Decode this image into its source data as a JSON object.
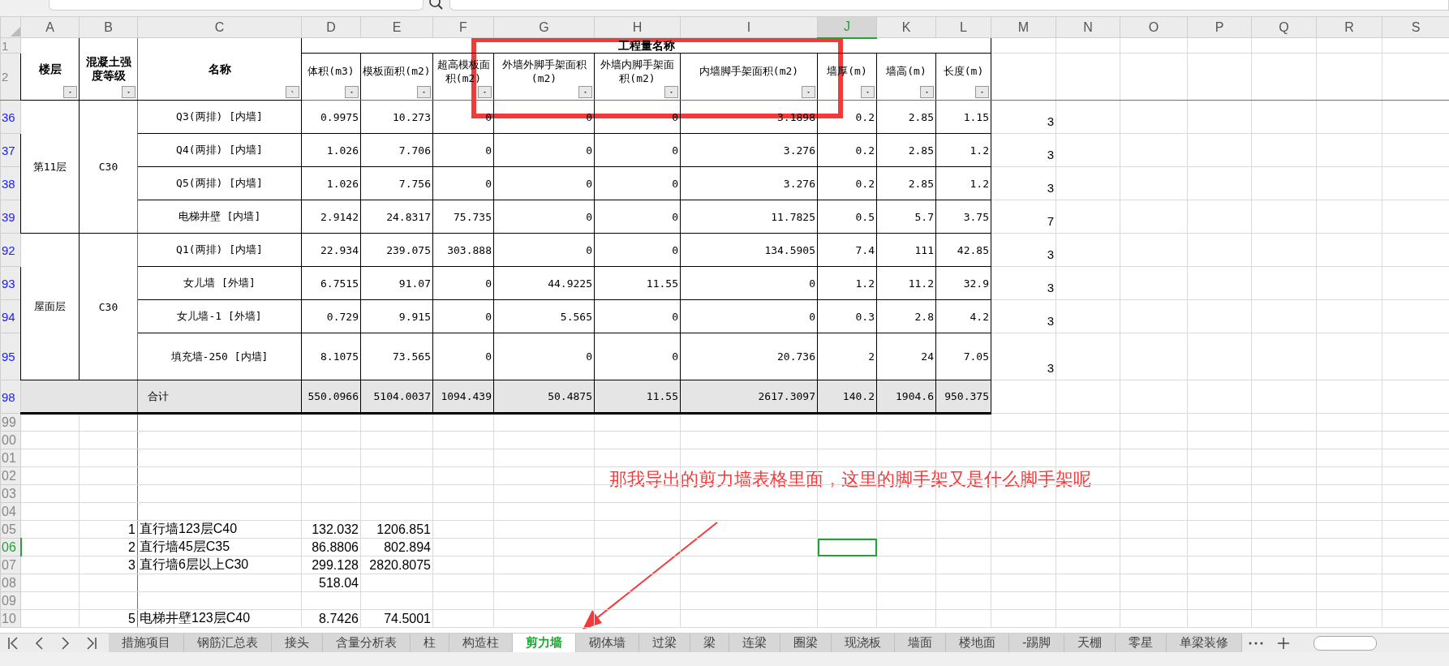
{
  "columns": [
    {
      "letter": "A",
      "selected": false
    },
    {
      "letter": "B",
      "selected": false
    },
    {
      "letter": "C",
      "selected": false
    },
    {
      "letter": "D",
      "selected": false
    },
    {
      "letter": "E",
      "selected": false
    },
    {
      "letter": "F",
      "selected": false
    },
    {
      "letter": "G",
      "selected": false
    },
    {
      "letter": "H",
      "selected": false
    },
    {
      "letter": "I",
      "selected": false
    },
    {
      "letter": "J",
      "selected": true
    },
    {
      "letter": "K",
      "selected": false
    },
    {
      "letter": "L",
      "selected": false
    },
    {
      "letter": "M",
      "selected": false
    },
    {
      "letter": "N",
      "selected": false
    },
    {
      "letter": "O",
      "selected": false
    },
    {
      "letter": "P",
      "selected": false
    },
    {
      "letter": "Q",
      "selected": false
    },
    {
      "letter": "R",
      "selected": false
    },
    {
      "letter": "S",
      "selected": false
    }
  ],
  "header": {
    "row_labels": [
      "1",
      "2"
    ],
    "frozen": [
      {
        "label": "楼层",
        "filter_applied": false
      },
      {
        "label": "混凝土强度等级",
        "filter_applied": false
      },
      {
        "label": "名称",
        "filter_applied": true
      }
    ],
    "group_title": "工程量名称",
    "fields": [
      {
        "label": "体积(m3)",
        "filter_applied": false
      },
      {
        "label": "模板面积(m2)",
        "filter_applied": false
      },
      {
        "label": "超高模板面积(m2)",
        "filter_applied": false
      },
      {
        "label": "外墙外脚手架面积(m2)",
        "filter_applied": false
      },
      {
        "label": "外墙内脚手架面积(m2)",
        "filter_applied": false
      },
      {
        "label": "内墙脚手架面积(m2)",
        "filter_applied": false
      },
      {
        "label": "墙厚(m)",
        "filter_applied": false
      },
      {
        "label": "墙高(m)",
        "filter_applied": false
      },
      {
        "label": "长度(m)",
        "filter_applied": false
      }
    ]
  },
  "groups": [
    {
      "floor": "第11层",
      "grade": "C30",
      "rows": [
        {
          "row": "36",
          "name": "Q3(两排) [内墙]",
          "values": [
            "0.9975",
            "10.273",
            "0",
            "0",
            "0",
            "3.1898",
            "0.2",
            "2.85",
            "1.15"
          ],
          "column_m": "3"
        },
        {
          "row": "37",
          "name": "Q4(两排) [内墙]",
          "values": [
            "1.026",
            "7.706",
            "0",
            "0",
            "0",
            "3.276",
            "0.2",
            "2.85",
            "1.2"
          ],
          "column_m": "3"
        },
        {
          "row": "38",
          "name": "Q5(两排) [内墙]",
          "values": [
            "1.026",
            "7.756",
            "0",
            "0",
            "0",
            "3.276",
            "0.2",
            "2.85",
            "1.2"
          ],
          "column_m": "3"
        },
        {
          "row": "39",
          "name": "电梯井壁 [内墙]",
          "values": [
            "2.9142",
            "24.8317",
            "75.735",
            "0",
            "0",
            "11.7825",
            "0.5",
            "5.7",
            "3.75"
          ],
          "column_m": "7"
        }
      ]
    },
    {
      "floor": "屋面层",
      "grade": "C30",
      "rows": [
        {
          "row": "92",
          "name": "Q1(两排) [内墙]",
          "values": [
            "22.934",
            "239.075",
            "303.888",
            "0",
            "0",
            "134.5905",
            "7.4",
            "111",
            "42.85"
          ],
          "column_m": "3"
        },
        {
          "row": "93",
          "name": "女儿墙 [外墙]",
          "values": [
            "6.7515",
            "91.07",
            "0",
            "44.9225",
            "11.55",
            "0",
            "1.2",
            "11.2",
            "32.9"
          ],
          "column_m": "3"
        },
        {
          "row": "94",
          "name": "女儿墙-1 [外墙]",
          "values": [
            "0.729",
            "9.915",
            "0",
            "5.565",
            "0",
            "0",
            "0.3",
            "2.8",
            "4.2"
          ],
          "column_m": "3"
        },
        {
          "row": "95",
          "name": "填充墙-250 [内墙]",
          "values": [
            "8.1075",
            "73.565",
            "0",
            "0",
            "0",
            "20.736",
            "2",
            "24",
            "7.05"
          ],
          "column_m": "3"
        }
      ]
    }
  ],
  "total": {
    "row": "98",
    "label": "合计",
    "values": [
      "550.0966",
      "5104.0037",
      "1094.439",
      "50.4875",
      "11.55",
      "2617.3097",
      "140.2",
      "1904.6",
      "950.375"
    ]
  },
  "extra_rows": [
    {
      "row": "99",
      "selected": false
    },
    {
      "row": "00",
      "selected": false
    },
    {
      "row": "01",
      "selected": false
    },
    {
      "row": "02",
      "selected": false
    },
    {
      "row": "03",
      "selected": false
    },
    {
      "row": "04",
      "selected": false
    },
    {
      "row": "05",
      "selected": false,
      "number": "1",
      "name": "直行墙123层C40",
      "volume": "132.032",
      "formwork": "1206.851"
    },
    {
      "row": "06",
      "selected": true,
      "number": "2",
      "name": "直行墙45层C35",
      "volume": "86.8806",
      "formwork": "802.894"
    },
    {
      "row": "07",
      "selected": false,
      "number": "3",
      "name": "直行墙6层以上C30",
      "volume": "299.128",
      "formwork": "2820.8075"
    },
    {
      "row": "08",
      "selected": false,
      "volume": "518.04"
    },
    {
      "row": "09",
      "selected": false
    },
    {
      "row": "10",
      "selected": false,
      "number": "5",
      "name": "电梯井壁123层C40",
      "volume": "8.7426",
      "formwork": "74.5001"
    }
  ],
  "annotation": {
    "text": "那我导出的剪力墙表格里面，这里的脚手架又是什么脚手架呢"
  },
  "sheet_tabs": [
    {
      "label": "措施项目",
      "selected": false
    },
    {
      "label": "钢筋汇总表",
      "selected": false
    },
    {
      "label": "接头",
      "selected": false
    },
    {
      "label": "含量分析表",
      "selected": false
    },
    {
      "label": "柱",
      "selected": false
    },
    {
      "label": "构造柱",
      "selected": false
    },
    {
      "label": "剪力墙",
      "selected": true
    },
    {
      "label": "砌体墙",
      "selected": false
    },
    {
      "label": "过梁",
      "selected": false
    },
    {
      "label": "梁",
      "selected": false
    },
    {
      "label": "连梁",
      "selected": false
    },
    {
      "label": "圈梁",
      "selected": false
    },
    {
      "label": "现浇板",
      "selected": false
    },
    {
      "label": "墙面",
      "selected": false
    },
    {
      "label": "楼地面",
      "selected": false
    },
    {
      "label": "-踢脚",
      "selected": false
    },
    {
      "label": "天棚",
      "selected": false
    },
    {
      "label": "零星",
      "selected": false
    },
    {
      "label": "单梁装修",
      "selected": false
    }
  ]
}
